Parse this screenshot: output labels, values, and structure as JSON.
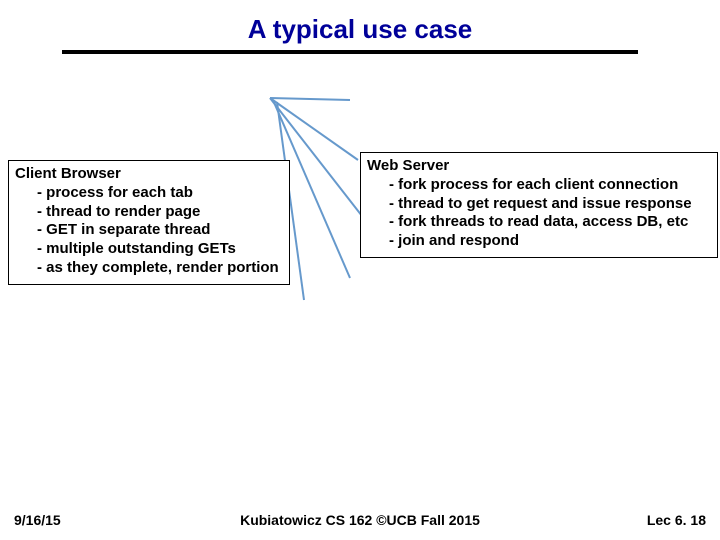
{
  "title": "A typical use case",
  "left": {
    "header": "Client Browser",
    "items": [
      "process for each tab",
      "thread to render page",
      "GET in separate thread",
      "multiple outstanding GETs",
      "as they complete, render portion"
    ]
  },
  "right": {
    "header": "Web Server",
    "items": [
      "fork process for each client connection",
      "thread to get request and issue response",
      "fork threads to read data, access DB, etc",
      "join and respond"
    ]
  },
  "footer": {
    "date": "9/16/15",
    "center": "Kubiatowicz CS 162 ©UCB Fall 2015",
    "lec": "Lec 6. 18"
  }
}
